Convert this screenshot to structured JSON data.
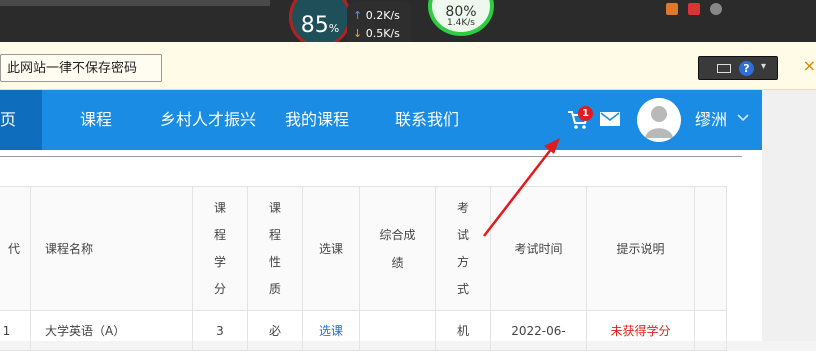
{
  "speed_meter": {
    "cpu_value": "85",
    "cpu_unit": "%",
    "upload": "0.2",
    "download": "0.5",
    "rate_unit": "K/s",
    "green_value": "80",
    "green_unit": "%",
    "green_rate": "1.4K/s"
  },
  "password_bar": {
    "never_save_label": "此网站一律不保存密码"
  },
  "navbar": {
    "home_label": "页",
    "items": [
      "课程",
      "乡村人才振兴",
      "我的课程",
      "联系我们"
    ],
    "cart_count": "1",
    "user_name": "缪洲",
    "colors": {
      "bar": "#1a8ce4",
      "active": "#0f6dbd",
      "badge": "#e21b1b"
    }
  },
  "table": {
    "headers": [
      "代",
      "课程名称",
      "课程学分",
      "课程性质",
      "选课",
      "综合成绩",
      "考试方式",
      "考试时间",
      "提示说明",
      ""
    ],
    "header_vertical": {
      "credit": [
        "课",
        "程",
        "学",
        "分"
      ],
      "nature": [
        "课",
        "程",
        "性",
        "质"
      ],
      "exam_mode": [
        "考",
        "试",
        "方",
        "式"
      ],
      "score": [
        "综合成",
        "绩"
      ]
    },
    "row": [
      "1",
      "大学英语（A）",
      "3",
      "必",
      "选课",
      "",
      "机",
      "2022-06-",
      "未获得学分",
      ""
    ]
  }
}
